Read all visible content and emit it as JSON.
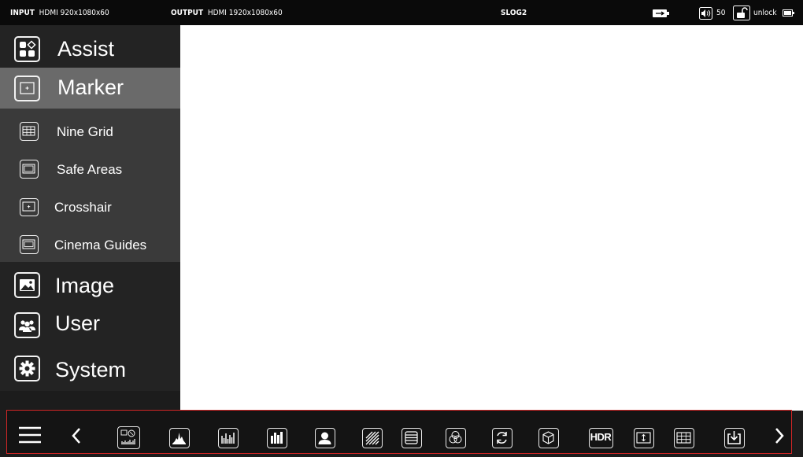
{
  "statusbar": {
    "input_label": "INPUT",
    "input_value": "HDMI 920x1080x60",
    "output_label": "OUTPUT",
    "output_value": "HDMI 1920x1080x60",
    "gamma": "SLOG2",
    "volume": "50",
    "lock_state": "unlock",
    "icons": [
      "usb-icon",
      "speaker-icon",
      "unlock-icon",
      "battery-icon"
    ]
  },
  "menu": {
    "items": [
      {
        "label": "Assist",
        "icon": "assist-icon"
      },
      {
        "label": "Marker",
        "icon": "marker-icon",
        "selected": true,
        "children": [
          {
            "label": "Nine Grid",
            "icon": "nine-grid-icon"
          },
          {
            "label": "Safe Areas",
            "icon": "safe-areas-icon"
          },
          {
            "label": "Crosshair",
            "icon": "crosshair-icon"
          },
          {
            "label": "Cinema Guides",
            "icon": "cinema-guides-icon"
          }
        ]
      },
      {
        "label": "Image",
        "icon": "image-icon"
      },
      {
        "label": "User",
        "icon": "user-icon"
      },
      {
        "label": "System",
        "icon": "gear-icon"
      }
    ]
  },
  "toolbar": {
    "hdr_label": "HDR",
    "icons": [
      "hamburger-menu-icon",
      "chevron-left-icon",
      "waveform-vectorscope-icon",
      "histogram-icon",
      "waveform-icon",
      "rgb-parade-icon",
      "skin-tone-icon",
      "zebra-icon",
      "false-color-icon",
      "color-overlap-icon",
      "rotate-icon",
      "lut-3d-icon",
      "hdr-icon",
      "anamorphic-icon",
      "grid-icon",
      "import-icon",
      "chevron-right-icon"
    ]
  },
  "colors": {
    "highlight": "#d02626",
    "selected_bg": "#6a6a6a",
    "submenu_bg": "#3a3a3a"
  }
}
